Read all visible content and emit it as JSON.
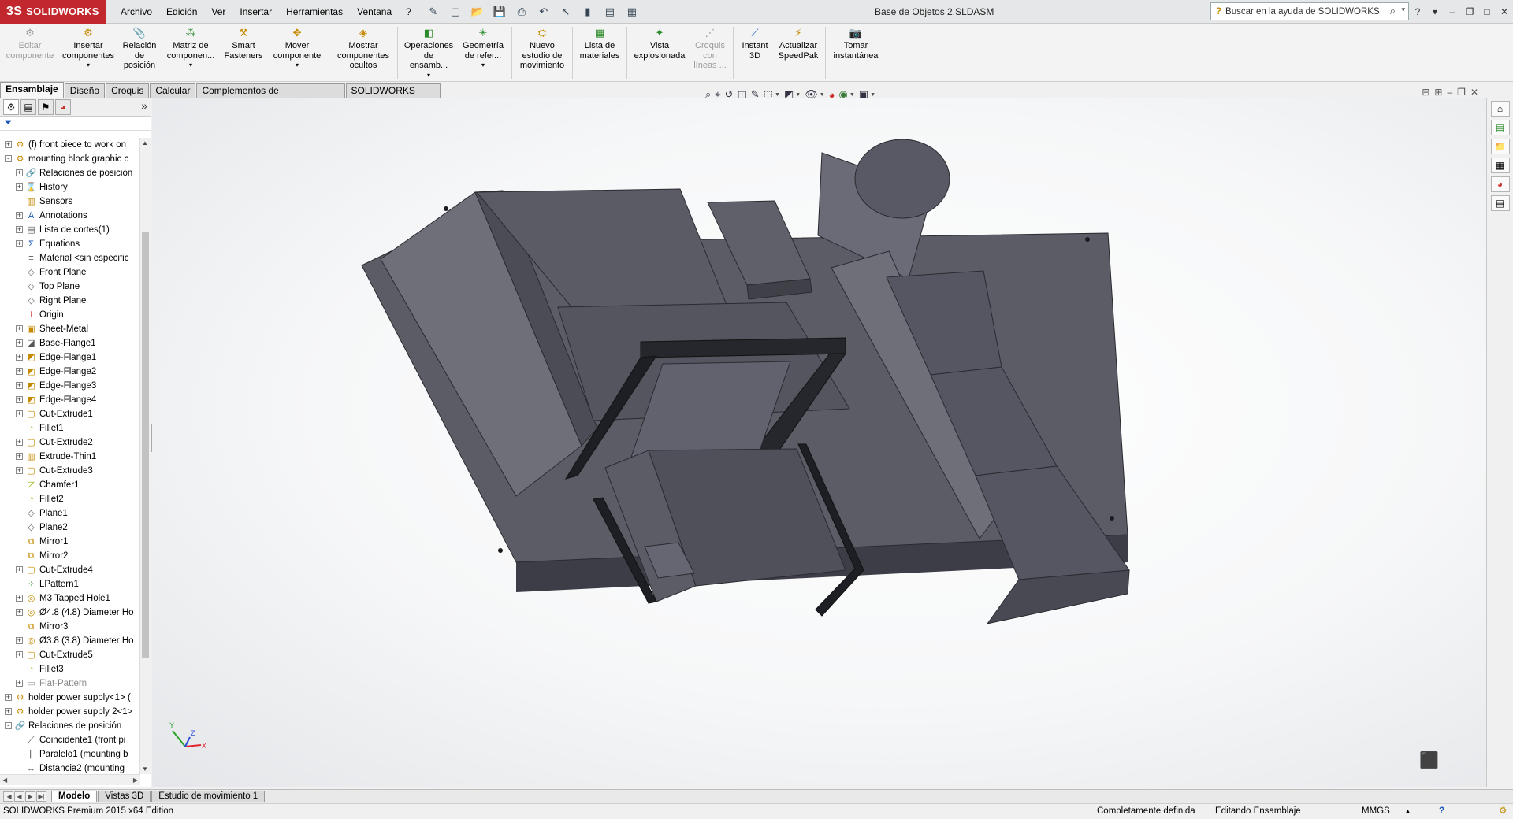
{
  "app": {
    "logo_mark": "3S",
    "logo_text": "SOLIDWORKS",
    "document_title": "Base de Objetos 2.SLDASM"
  },
  "menu": [
    "Archivo",
    "Edición",
    "Ver",
    "Insertar",
    "Herramientas",
    "Ventana",
    "?"
  ],
  "help_search": {
    "placeholder": "Buscar en la ayuda de SOLIDWORKS"
  },
  "command_manager": [
    {
      "label": "Editar componente",
      "icon": "edit-component-icon",
      "enabled": false
    },
    {
      "label": "Insertar componentes",
      "icon": "insert-components-icon",
      "enabled": true
    },
    {
      "label": "Relación de posición",
      "icon": "mate-icon",
      "enabled": true
    },
    {
      "label": "Matriz de componen...",
      "icon": "component-pattern-icon",
      "enabled": true
    },
    {
      "label": "Smart Fasteners",
      "icon": "smart-fasteners-icon",
      "enabled": true
    },
    {
      "label": "Mover componente",
      "icon": "move-component-icon",
      "enabled": true
    },
    {
      "label": "Mostrar componentes ocultos",
      "icon": "show-hidden-icon",
      "enabled": true
    },
    {
      "label": "Operaciones de ensamb...",
      "icon": "assembly-features-icon",
      "enabled": true
    },
    {
      "label": "Geometría de refer...",
      "icon": "reference-geometry-icon",
      "enabled": true
    },
    {
      "label": "Nuevo estudio de movimiento",
      "icon": "motion-study-icon",
      "enabled": true
    },
    {
      "label": "Lista de materiales",
      "icon": "bom-icon",
      "enabled": true
    },
    {
      "label": "Vista explosionada",
      "icon": "exploded-view-icon",
      "enabled": true
    },
    {
      "label": "Croquis con líneas ...",
      "icon": "explode-line-sketch-icon",
      "enabled": false
    },
    {
      "label": "Instant 3D",
      "icon": "instant3d-icon",
      "enabled": true
    },
    {
      "label": "Actualizar SpeedPak",
      "icon": "speedpak-icon",
      "enabled": true
    },
    {
      "label": "Tomar instantánea",
      "icon": "snapshot-icon",
      "enabled": true
    }
  ],
  "tabs": [
    "Ensamblaje",
    "Diseño",
    "Croquis",
    "Calcular",
    "Complementos de SOLIDWORKS",
    "SOLIDWORKS MBD"
  ],
  "tree": [
    {
      "label": "(f) front piece to work on",
      "icon": "part-icon",
      "indent": 0,
      "expander": "+"
    },
    {
      "label": "mounting block graphic c",
      "icon": "part-icon",
      "indent": 0,
      "expander": "-"
    },
    {
      "label": "Relaciones de posición",
      "icon": "mates-folder-icon",
      "indent": 1,
      "expander": "+"
    },
    {
      "label": "History",
      "icon": "history-icon",
      "indent": 1,
      "expander": "+"
    },
    {
      "label": "Sensors",
      "icon": "sensors-folder-icon",
      "indent": 1,
      "expander": ""
    },
    {
      "label": "Annotations",
      "icon": "annotations-icon",
      "indent": 1,
      "expander": "+"
    },
    {
      "label": "Lista de cortes(1)",
      "icon": "cut-list-icon",
      "indent": 1,
      "expander": "+"
    },
    {
      "label": "Equations",
      "icon": "equations-icon",
      "indent": 1,
      "expander": "+"
    },
    {
      "label": "Material <sin especific",
      "icon": "material-icon",
      "indent": 1,
      "expander": ""
    },
    {
      "label": "Front Plane",
      "icon": "plane-icon",
      "indent": 1,
      "expander": ""
    },
    {
      "label": "Top Plane",
      "icon": "plane-icon",
      "indent": 1,
      "expander": ""
    },
    {
      "label": "Right Plane",
      "icon": "plane-icon",
      "indent": 1,
      "expander": ""
    },
    {
      "label": "Origin",
      "icon": "origin-icon",
      "indent": 1,
      "expander": ""
    },
    {
      "label": "Sheet-Metal",
      "icon": "sheet-metal-icon",
      "indent": 1,
      "expander": "+"
    },
    {
      "label": "Base-Flange1",
      "icon": "base-flange-icon",
      "indent": 1,
      "expander": "+"
    },
    {
      "label": "Edge-Flange1",
      "icon": "edge-flange-icon",
      "indent": 1,
      "expander": "+"
    },
    {
      "label": "Edge-Flange2",
      "icon": "edge-flange-icon",
      "indent": 1,
      "expander": "+"
    },
    {
      "label": "Edge-Flange3",
      "icon": "edge-flange-icon",
      "indent": 1,
      "expander": "+"
    },
    {
      "label": "Edge-Flange4",
      "icon": "edge-flange-icon",
      "indent": 1,
      "expander": "+"
    },
    {
      "label": "Cut-Extrude1",
      "icon": "cut-extrude-icon",
      "indent": 1,
      "expander": "+"
    },
    {
      "label": "Fillet1",
      "icon": "fillet-icon",
      "indent": 1,
      "expander": ""
    },
    {
      "label": "Cut-Extrude2",
      "icon": "cut-extrude-icon",
      "indent": 1,
      "expander": "+"
    },
    {
      "label": "Extrude-Thin1",
      "icon": "extrude-icon",
      "indent": 1,
      "expander": "+"
    },
    {
      "label": "Cut-Extrude3",
      "icon": "cut-extrude-icon",
      "indent": 1,
      "expander": "+"
    },
    {
      "label": "Chamfer1",
      "icon": "chamfer-icon",
      "indent": 1,
      "expander": ""
    },
    {
      "label": "Fillet2",
      "icon": "fillet-icon",
      "indent": 1,
      "expander": ""
    },
    {
      "label": "Plane1",
      "icon": "plane-icon",
      "indent": 1,
      "expander": ""
    },
    {
      "label": "Plane2",
      "icon": "plane-icon",
      "indent": 1,
      "expander": ""
    },
    {
      "label": "Mirror1",
      "icon": "mirror-icon",
      "indent": 1,
      "expander": ""
    },
    {
      "label": "Mirror2",
      "icon": "mirror-icon",
      "indent": 1,
      "expander": ""
    },
    {
      "label": "Cut-Extrude4",
      "icon": "cut-extrude-icon",
      "indent": 1,
      "expander": "+"
    },
    {
      "label": "LPattern1",
      "icon": "linear-pattern-icon",
      "indent": 1,
      "expander": ""
    },
    {
      "label": "M3 Tapped Hole1",
      "icon": "hole-icon",
      "indent": 1,
      "expander": "+"
    },
    {
      "label": "Ø4.8 (4.8) Diameter Ho",
      "icon": "hole-icon",
      "indent": 1,
      "expander": "+"
    },
    {
      "label": "Mirror3",
      "icon": "mirror-icon",
      "indent": 1,
      "expander": ""
    },
    {
      "label": "Ø3.8 (3.8) Diameter Ho",
      "icon": "hole-icon",
      "indent": 1,
      "expander": "+"
    },
    {
      "label": "Cut-Extrude5",
      "icon": "cut-extrude-icon",
      "indent": 1,
      "expander": "+"
    },
    {
      "label": "Fillet3",
      "icon": "fillet-icon",
      "indent": 1,
      "expander": ""
    },
    {
      "label": "Flat-Pattern",
      "icon": "flat-pattern-icon",
      "indent": 1,
      "expander": "+",
      "greyed": true
    },
    {
      "label": "holder power supply<1> (",
      "icon": "part-icon",
      "indent": 0,
      "expander": "+"
    },
    {
      "label": "holder power supply 2<1>",
      "icon": "part-icon",
      "indent": 0,
      "expander": "+"
    },
    {
      "label": "Relaciones de posición",
      "icon": "mates-folder-icon",
      "indent": 0,
      "expander": "-"
    },
    {
      "label": "Coincidente1 (front pi",
      "icon": "coincident-mate-icon",
      "indent": 1,
      "expander": ""
    },
    {
      "label": "Paralelo1 (mounting b",
      "icon": "parallel-mate-icon",
      "indent": 1,
      "expander": ""
    },
    {
      "label": "Distancia2 (mounting",
      "icon": "distance-mate-icon",
      "indent": 1,
      "expander": ""
    }
  ],
  "bottom_tabs": [
    "Modelo",
    "Vistas 3D",
    "Estudio de movimiento 1"
  ],
  "status": {
    "edition": "SOLIDWORKS Premium 2015 x64 Edition",
    "definition": "Completamente definida",
    "mode": "Editando Ensamblaje",
    "units": "MMGS"
  },
  "triad": {
    "x_label": "X",
    "y_label": "Y",
    "z_label": "Z"
  },
  "colors": {
    "logo_red": "#c1272d",
    "model_top": "#5b5c66",
    "model_side": "#4a4b54",
    "model_dark": "#26272c",
    "model_highlight": "#8a8b96",
    "axis_x": "#e0262c",
    "axis_y": "#2aa22a",
    "axis_z": "#2a4fd6"
  }
}
